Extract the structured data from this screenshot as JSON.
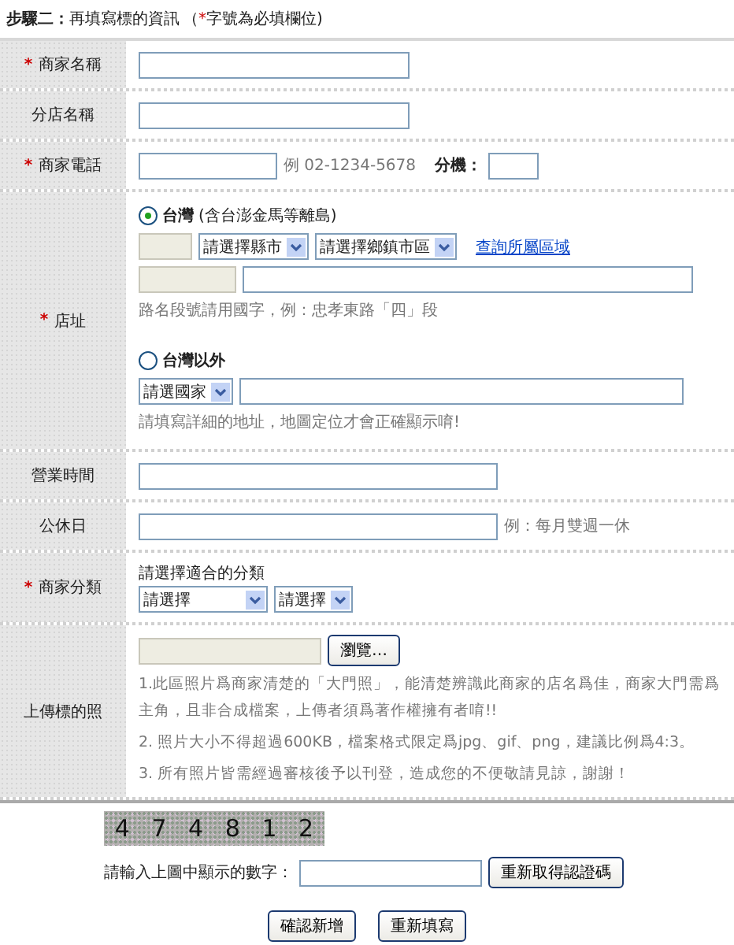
{
  "heading": {
    "step": "步驟二：",
    "title": "再填寫標的資訊",
    "note_open": "（",
    "note_mark": "*",
    "note_close": "字號為必填欄位)"
  },
  "required_mark": "*",
  "rows": [
    {
      "kind": "text",
      "label": "商家名稱",
      "required": true
    },
    {
      "kind": "text",
      "label": "分店名稱",
      "required": false
    },
    {
      "kind": "phone",
      "label": "商家電話",
      "required": true,
      "hint": "例 02-1234-5678",
      "ext_label": "分機："
    },
    {
      "kind": "address",
      "label": "店址",
      "required": true,
      "local": {
        "label": "台灣",
        "suffix": "(含台澎金馬等離島)",
        "selected": true,
        "city": "請選擇縣市",
        "district": "請選擇鄉鎮市區",
        "link": "查詢所屬區域",
        "hint": "路名段號請用國字，例：忠孝東路「四」段"
      },
      "abroad": {
        "label": "台灣以外",
        "selected": false,
        "country": "請選國家",
        "hint": "請填寫詳細的地址，地圖定位才會正確顯示唷!"
      }
    },
    {
      "kind": "wide",
      "label": "營業時間",
      "required": false
    },
    {
      "kind": "wide",
      "label": "公休日",
      "required": false,
      "hint": "例：每月雙週一休"
    },
    {
      "kind": "category",
      "label": "商家分類",
      "required": true,
      "prompt": "請選擇適合的分類",
      "selects": [
        "請選擇",
        "請選擇"
      ]
    },
    {
      "kind": "upload",
      "label": "上傳標的照",
      "required": false,
      "button": "瀏覽…",
      "notes": [
        "1.此區照片爲商家清楚的「大門照」，能清楚辨識此商家的店名爲佳，商家大門需爲主角，且非合成檔案，上傳者須爲著作權擁有者唷!!",
        "2. 照片大小不得超過600KB，檔案格式限定爲jpg、gif、png，建議比例爲4:3。",
        "3. 所有照片皆需經過審核後予以刊登，造成您的不便敬請見諒，謝謝！"
      ]
    }
  ],
  "captcha": {
    "digits": [
      "4",
      "7",
      "4",
      "8",
      "1",
      "2"
    ],
    "label": "請輸入上圖中顯示的數字：",
    "refresh": "重新取得認證碼"
  },
  "buttons": [
    "確認新增",
    "重新填寫"
  ]
}
